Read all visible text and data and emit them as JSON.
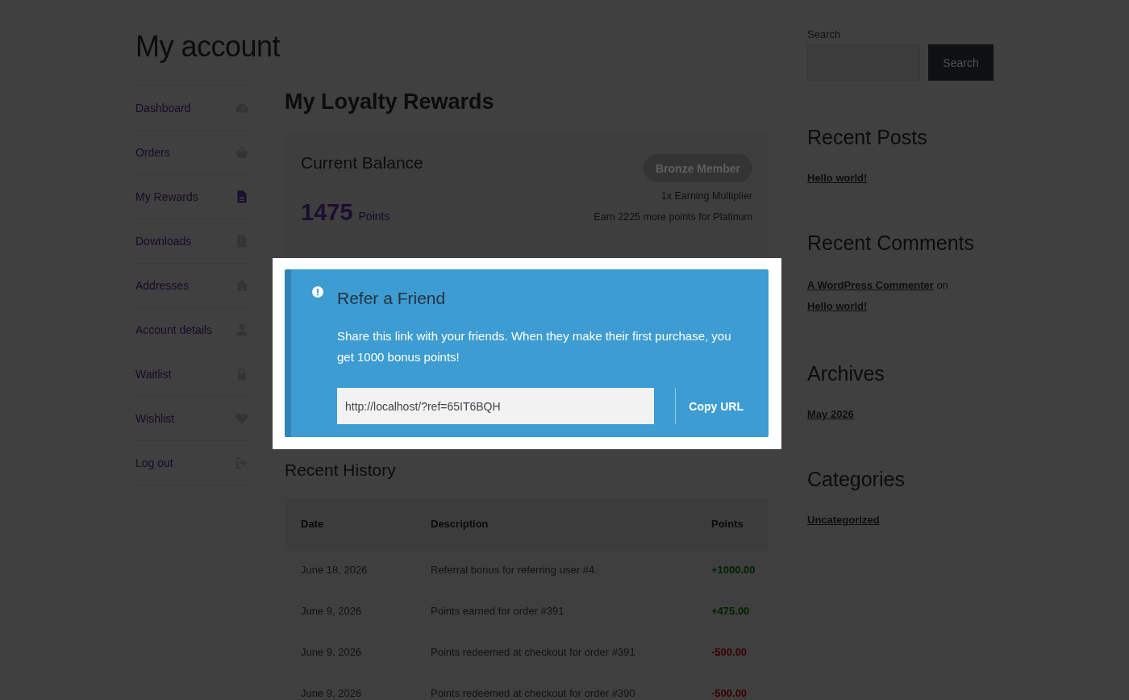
{
  "page_title": "My account",
  "account_nav": [
    {
      "label": "Dashboard",
      "selected": false
    },
    {
      "label": "Orders",
      "selected": false
    },
    {
      "label": "My Rewards",
      "selected": true
    },
    {
      "label": "Downloads",
      "selected": false
    },
    {
      "label": "Addresses",
      "selected": false
    },
    {
      "label": "Account details",
      "selected": false
    },
    {
      "label": "Waitlist",
      "selected": false
    },
    {
      "label": "Wishlist",
      "selected": false
    },
    {
      "label": "Log out",
      "selected": false
    }
  ],
  "main": {
    "heading": "My Loyalty Rewards",
    "balance": {
      "title": "Current Balance",
      "points": "1475",
      "unit": "Points",
      "tier_badge": "Bronze Member",
      "multiplier": "1x Earning Multiplier",
      "next_tier": "Earn 2225 more points for Platinum"
    },
    "refer_friend": {
      "highlighted": true,
      "title": "Refer a Friend",
      "text": "Share this link with your friends. When they make their first purchase, you get 1000 bonus points!",
      "url_value": "http://localhost/?ref=65IT6BQH",
      "copy_button": "Copy URL"
    },
    "history": {
      "heading": "Recent History",
      "columns": [
        "Date",
        "Description",
        "Points"
      ],
      "rows": [
        {
          "date": "June 18, 2026",
          "description": "Referral bonus for referring user #4.",
          "points": "+1000.00",
          "color": "#002000"
        },
        {
          "date": "June 9, 2026",
          "description": "Points earned for order #391",
          "points": "+475.00",
          "color": "#002000"
        },
        {
          "date": "June 9, 2026",
          "description": "Points redeemed at checkout for order #391",
          "points": "-500.00",
          "color": "#3a0000"
        },
        {
          "date": "June 9, 2026",
          "description": "Points redeemed at checkout for order #390",
          "points": "-500.00",
          "color": "#3a0000"
        }
      ]
    }
  },
  "sidebar": {
    "search": {
      "label": "Search",
      "button": "Search"
    },
    "widgets": [
      {
        "kind": "links",
        "heading": "Recent Posts",
        "links": [
          "Hello world!"
        ]
      },
      {
        "kind": "comments",
        "heading": "Recent Comments",
        "comments": [
          {
            "author": "A WordPress Commenter",
            "joiner": "on",
            "post": "Hello world!"
          }
        ]
      },
      {
        "kind": "links",
        "heading": "Archives",
        "links": [
          "May 2026"
        ]
      },
      {
        "kind": "links",
        "heading": "Categories",
        "links": [
          "Uncategorized"
        ]
      }
    ]
  }
}
